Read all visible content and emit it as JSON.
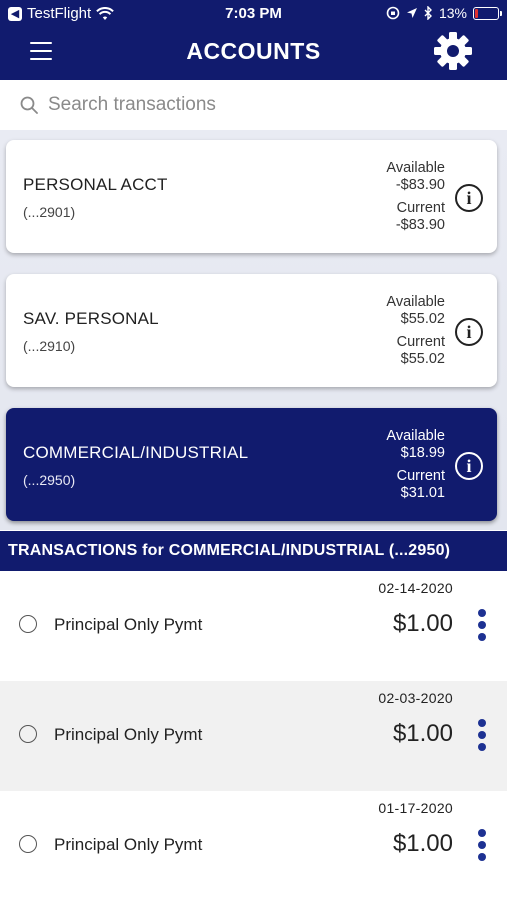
{
  "status_bar": {
    "app_back": "TestFlight",
    "time": "7:03 PM",
    "battery": "13%",
    "battery_level": 0.13,
    "battery_color": "#e03030"
  },
  "nav": {
    "title": "ACCOUNTS",
    "menu_icon": "hamburger-icon",
    "settings_icon": "gear-icon"
  },
  "search": {
    "placeholder": "Search transactions",
    "value": ""
  },
  "accounts": [
    {
      "name": "PERSONAL ACCT",
      "number": "(...2901)",
      "available_label": "Available",
      "available": "-$83.90",
      "current_label": "Current",
      "current": "-$83.90",
      "selected": false
    },
    {
      "name": "SAV. PERSONAL",
      "number": "(...2910)",
      "available_label": "Available",
      "available": "$55.02",
      "current_label": "Current",
      "current": "$55.02",
      "selected": false
    },
    {
      "name": "COMMERCIAL/INDUSTRIAL",
      "number": "(...2950)",
      "available_label": "Available",
      "available": "$18.99",
      "current_label": "Current",
      "current": "$31.01",
      "selected": true
    }
  ],
  "transactions_header": "TRANSACTIONS for COMMERCIAL/INDUSTRIAL (...2950)",
  "transactions": [
    {
      "date": "02-14-2020",
      "description": "Principal Only Pymt",
      "amount": "$1.00"
    },
    {
      "date": "02-03-2020",
      "description": "Principal Only Pymt",
      "amount": "$1.00"
    },
    {
      "date": "01-17-2020",
      "description": "Principal Only Pymt",
      "amount": "$1.00"
    }
  ],
  "colors": {
    "brand_navy": "#111b6e",
    "kebab_blue": "#1d3192",
    "alt_row": "#f1f1f1"
  }
}
